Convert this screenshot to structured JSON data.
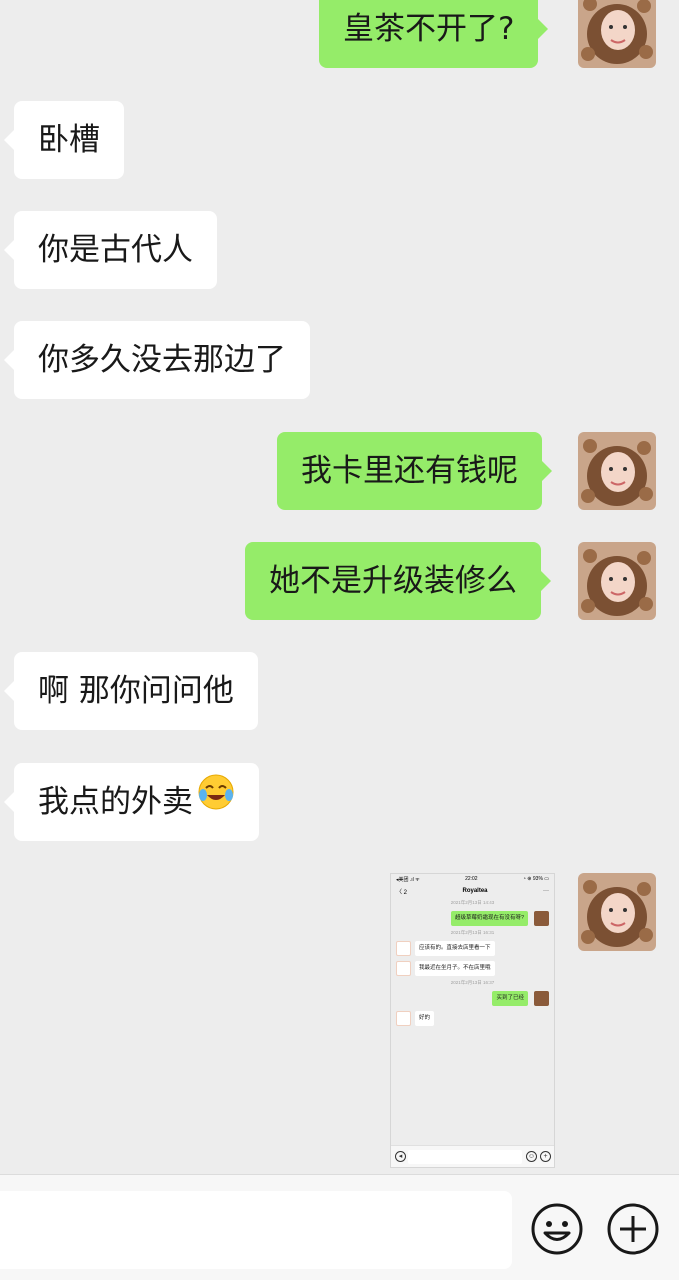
{
  "messages": [
    {
      "side": "out",
      "text": "皇茶不开了?"
    },
    {
      "side": "in",
      "text": "卧槽"
    },
    {
      "side": "in",
      "text": "你是古代人"
    },
    {
      "side": "in",
      "text": "你多久没去那边了"
    },
    {
      "side": "out",
      "text": "我卡里还有钱呢"
    },
    {
      "side": "out",
      "text": "她不是升级装修么"
    },
    {
      "side": "in",
      "text": "啊 那你问问他"
    },
    {
      "side": "in",
      "text": "我点的外卖",
      "emoji": "laughing-crying-emoji"
    }
  ],
  "image_message": {
    "status_bar": {
      "left": "◂美团 .ıl ᯤ",
      "time": "22:02",
      "right": "◔ ⊕ 93% ▭"
    },
    "nav": {
      "back": "〈 2",
      "title": "Royaltea",
      "more": "···"
    },
    "items": [
      {
        "kind": "time",
        "text": "2021年2月13日 14:43"
      },
      {
        "kind": "out",
        "text": "超级草莓奶霜现在有没有呀?"
      },
      {
        "kind": "time",
        "text": "2021年2月13日 16:31"
      },
      {
        "kind": "in",
        "text": "应该有的。直接去店里看一下"
      },
      {
        "kind": "in",
        "text": "我最近在坐月子。不在店里哦"
      },
      {
        "kind": "time",
        "text": "2021年2月13日 16:37"
      },
      {
        "kind": "out",
        "text": "买到了已经"
      },
      {
        "kind": "in",
        "text": "好的"
      }
    ]
  },
  "input_bar": {
    "emoji_icon": "smiley-icon",
    "add_icon": "plus-circle-icon"
  },
  "colors": {
    "background": "#ededed",
    "bubble_out": "#95ec69",
    "bubble_in": "#ffffff"
  }
}
